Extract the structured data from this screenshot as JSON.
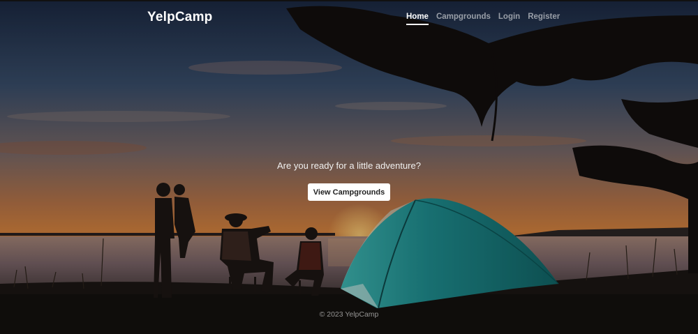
{
  "brand": {
    "name": "YelpCamp"
  },
  "nav": {
    "links": [
      {
        "label": "Home",
        "active": true
      },
      {
        "label": "Campgrounds",
        "active": false
      },
      {
        "label": "Login",
        "active": false
      },
      {
        "label": "Register",
        "active": false
      }
    ]
  },
  "hero": {
    "tagline": "Are you ready for a little adventure?",
    "button_label": "View Campgrounds"
  },
  "footer": {
    "text": "© 2023 YelpCamp"
  },
  "colors": {
    "nav_active": "#ffffff",
    "nav_inactive": "rgba(255,255,255,0.55)",
    "tent": "#1f8a8c",
    "sky_top": "#2a3b5c",
    "horizon": "#d9824a"
  }
}
